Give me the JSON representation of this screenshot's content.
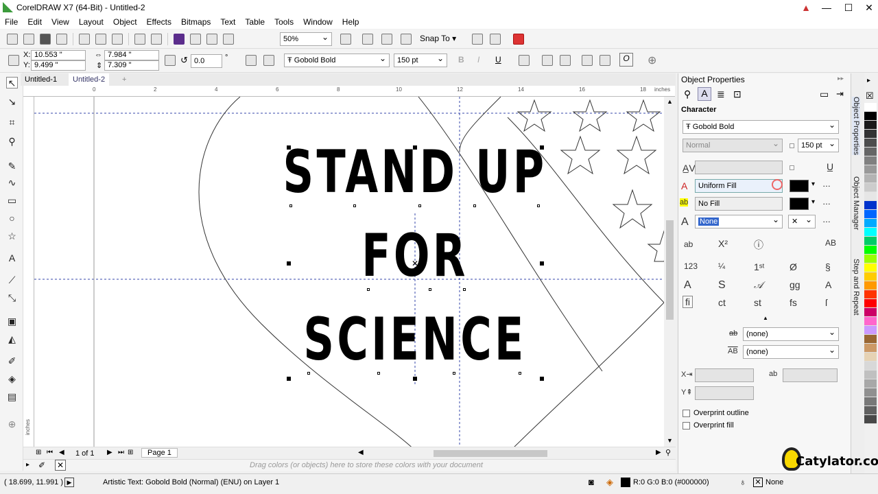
{
  "window": {
    "title": "CorelDRAW X7 (64-Bit) - Untitled-2"
  },
  "menu": [
    "File",
    "Edit",
    "View",
    "Layout",
    "Object",
    "Effects",
    "Bitmaps",
    "Text",
    "Table",
    "Tools",
    "Window",
    "Help"
  ],
  "standard_bar": {
    "zoom": "50%",
    "snap_to": "Snap To"
  },
  "property_bar": {
    "x": "10.553 \"",
    "y": "9.499 \"",
    "width": "7.984 \"",
    "height": "7.309 \"",
    "rotation": "0.0",
    "degree": "°",
    "font": "Gobold Bold",
    "size": "150 pt",
    "x_label": "X:",
    "y_label": "Y:"
  },
  "tabs": [
    "Untitled-1",
    "Untitled-2"
  ],
  "ruler": {
    "unit": "inches",
    "h_labels": [
      "0",
      "2",
      "4",
      "6",
      "8",
      "10",
      "12",
      "14",
      "16",
      "18"
    ],
    "v_unit": "inches"
  },
  "artwork": {
    "lines": [
      "STAND UP",
      "FOR",
      "SCIENCE"
    ]
  },
  "page_nav": {
    "count": "1 of 1",
    "page_tab": "Page 1"
  },
  "doc_palette_hint": "Drag colors (or objects) here to store these colors with your document",
  "status": {
    "coords": "( 18.699, 11.991 )",
    "object": "Artistic Text: Gobold Bold (Normal) (ENU) on Layer 1",
    "fill": "R:0 G:0 B:0 (#000000)",
    "outline": "None"
  },
  "panel": {
    "title": "Object Properties",
    "section": "Character",
    "font": "Gobold Bold",
    "style": "Normal",
    "size": "150 pt",
    "text_fill": "Uniform Fill",
    "bg_fill": "No Fill",
    "outline": "None",
    "underline_a": "(none)",
    "underline_b": "(none)",
    "overprint_outline": "Overprint outline",
    "overprint_fill": "Overprint fill"
  },
  "side_tabs": [
    "Object Properties",
    "Object Manager",
    "Step and Repeat"
  ],
  "palette": [
    "#ffffff",
    "#000000",
    "#1a1a1a",
    "#333333",
    "#4d4d4d",
    "#666666",
    "#808080",
    "#999999",
    "#b3b3b3",
    "#cccccc",
    "#e6e6e6",
    "#0033cc",
    "#0066ff",
    "#00aaff",
    "#00ffff",
    "#00cc66",
    "#00ff00",
    "#99ff00",
    "#ffff00",
    "#ffcc00",
    "#ff9900",
    "#ff3300",
    "#ff0000",
    "#cc0066",
    "#ff66cc",
    "#cc99ff",
    "#996633",
    "#cc9966",
    "#e6d2b4",
    "#d8d8d8",
    "#c0c0c0",
    "#a8a8a8",
    "#909090",
    "#787878",
    "#606060",
    "#484848"
  ],
  "watermark": "Catylator.com"
}
